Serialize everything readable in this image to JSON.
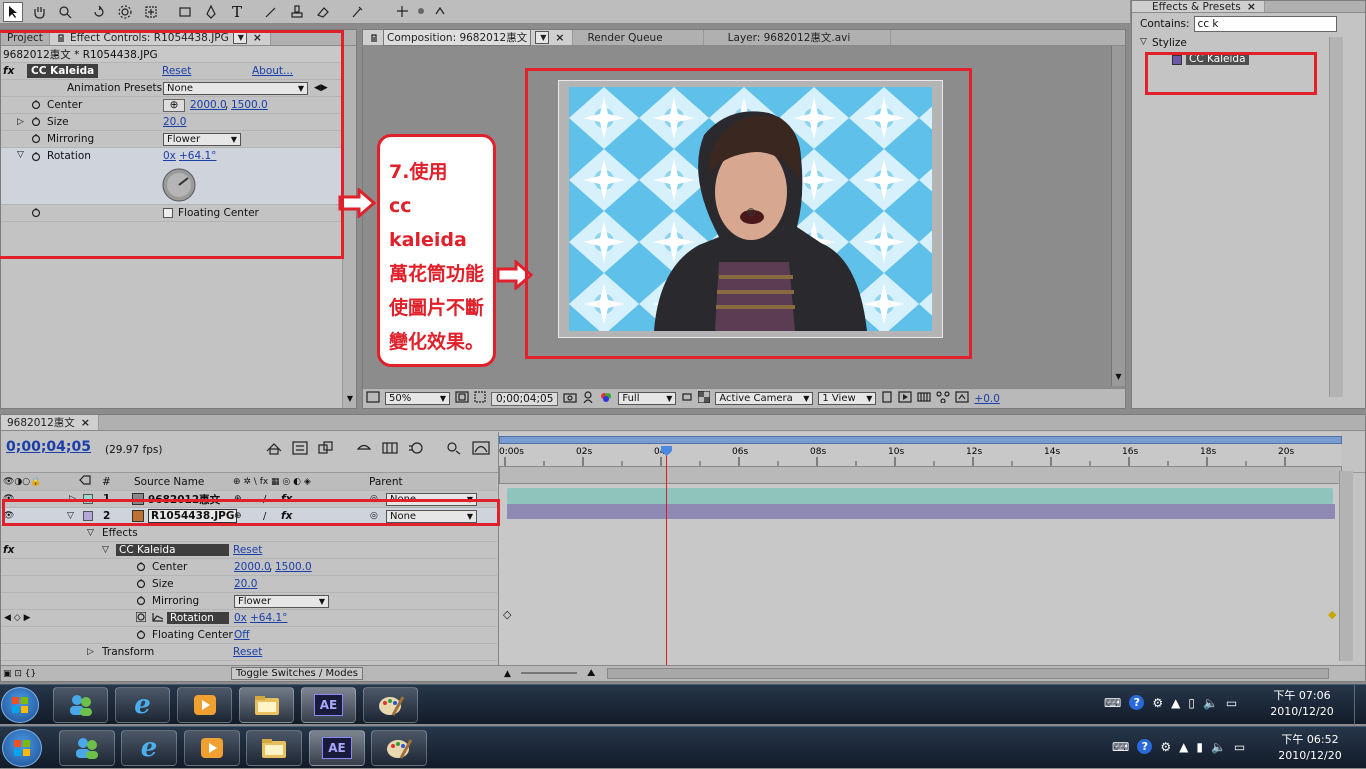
{
  "toolbar": {
    "tools": [
      "arrow-tool",
      "hand-tool",
      "zoom-tool",
      "rotate-tool",
      "orbit-camera-tool",
      "pan-tool",
      "rectangle-tool",
      "pen-tool",
      "text-tool",
      "brush-tool",
      "clone-stamp-tool",
      "eraser-tool",
      "puppet-tool"
    ]
  },
  "left_tabs": {
    "project": "Project",
    "effect_controls": "Effect Controls: R1054438.JPG"
  },
  "effect_controls": {
    "breadcrumb": "9682012惠文 * R1054438.JPG",
    "effect_name": "CC Kaleida",
    "reset": "Reset",
    "about": "About...",
    "anim_presets_label": "Animation Presets:",
    "anim_presets_value": "None",
    "center_label": "Center",
    "center_x": "2000.0",
    "center_y": "1500.0",
    "size_label": "Size",
    "size_value": "20.0",
    "mirroring_label": "Mirroring",
    "mirroring_value": "Flower",
    "rotation_label": "Rotation",
    "rotation_rev": "0x",
    "rotation_deg": "+64.1°",
    "floating_label": "Floating Center"
  },
  "comp_tabs": {
    "composition": "Composition: 9682012惠文",
    "render_queue": "Render Queue",
    "layer": "Layer: 9682012惠文.avi"
  },
  "comp_footer": {
    "zoom": "50%",
    "time": "0;00;04;05",
    "resolution": "Full",
    "camera": "Active Camera",
    "views": "1 View",
    "exposure": "+0.0"
  },
  "annotation": {
    "line1": "7.使用",
    "line2": "cc kaleida",
    "line3": "萬花筒功能",
    "line4": "使圖片不斷",
    "line5": "變化效果。"
  },
  "effects_presets": {
    "tab": "Effects & Presets",
    "contains_label": "Contains:",
    "search_value": "cc k",
    "category": "Stylize",
    "item": "CC Kaleida"
  },
  "timeline": {
    "tab": "9682012惠文",
    "timecode": "0;00;04;05",
    "fps": "(29.97 fps)",
    "col_num": "#",
    "col_source": "Source Name",
    "col_parent": "Parent",
    "ruler": [
      "0:00s",
      "02s",
      "04s",
      "06s",
      "08s",
      "10s",
      "12s",
      "14s",
      "16s",
      "18s",
      "20s"
    ],
    "layers": [
      {
        "num": "1",
        "name": "9682012惠文",
        "parent": "None"
      },
      {
        "num": "2",
        "name": "R1054438.JPG",
        "parent": "None"
      }
    ],
    "effects_label": "Effects",
    "effect_name": "CC Kaleida",
    "reset": "Reset",
    "center_label": "Center",
    "center_x": "2000.0",
    "center_y": "1500.0",
    "size_label": "Size",
    "size_value": "20.0",
    "mirroring_label": "Mirroring",
    "mirroring_value": "Flower",
    "rotation_label": "Rotation",
    "rotation_rev": "0x",
    "rotation_deg": "+64.1°",
    "floating_label": "Floating Center",
    "floating_value": "Off",
    "transform_label": "Transform",
    "transform_reset": "Reset",
    "toggle": "Toggle Switches / Modes"
  },
  "taskbar1": {
    "time": "下午 07:06",
    "date": "2010/12/20"
  },
  "taskbar2": {
    "time": "下午 06:52",
    "date": "2010/12/20"
  },
  "colors": {
    "annotation_red": "#e0202a",
    "link_blue": "#1a3fa8",
    "playhead": "#d42020",
    "layer1_bar": "#8fc4bd",
    "layer2_bar": "#8e8ab3"
  }
}
